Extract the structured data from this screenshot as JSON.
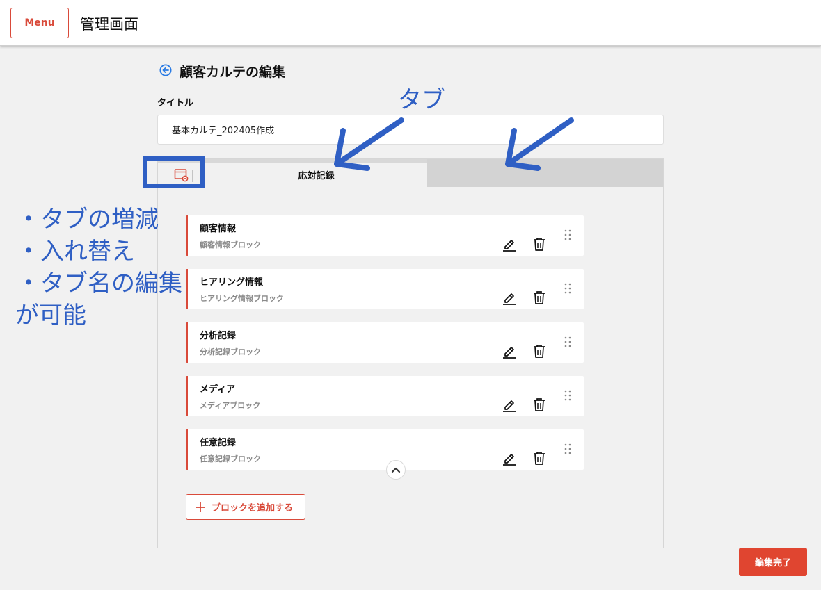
{
  "header": {
    "menu_label": "Menu",
    "app_title": "管理画面"
  },
  "page": {
    "title": "顧客カルテの編集",
    "title_field_label": "タイトル",
    "title_value": "基本カルテ_202405作成"
  },
  "tabs": [
    {
      "label": "応対記録",
      "active": true
    }
  ],
  "blocks": [
    {
      "name": "顧客情報",
      "sub": "顧客情報ブロック"
    },
    {
      "name": "ヒアリング情報",
      "sub": "ヒアリング情報ブロック"
    },
    {
      "name": "分析記録",
      "sub": "分析記録ブロック"
    },
    {
      "name": "メディア",
      "sub": "メディアブロック"
    },
    {
      "name": "任意記録",
      "sub": "任意記録ブロック"
    }
  ],
  "add_block_label": "ブロックを追加する",
  "done_label": "編集完了",
  "annotations": {
    "tab_label": "タブ",
    "notes": [
      "・タブの増減",
      "・入れ替え",
      "・タブ名の編集",
      "が可能"
    ]
  },
  "colors": {
    "accent": "#d94a3a",
    "done_button": "#e04530",
    "annotation": "#2f5fc4",
    "back_icon": "#2a7be4"
  },
  "icons": {
    "back": "circle-arrow-left-icon",
    "tab_settings": "window-gear-icon",
    "edit": "pencil-icon",
    "delete": "trash-icon",
    "drag": "drag-handle-icon",
    "collapse": "chevron-up-icon",
    "add": "plus-icon"
  }
}
